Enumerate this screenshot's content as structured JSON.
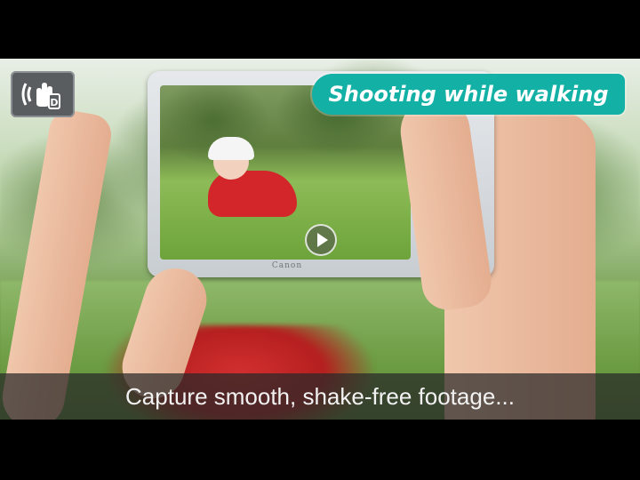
{
  "video": {
    "title_badge": "Shooting while walking",
    "caption": "Capture smooth, shake-free footage...",
    "camera_brand": "Canon",
    "mode_icon": "image-stabilizer-hand-icon",
    "play_icon": "play-icon",
    "colors": {
      "title_pill": "#12b0a5",
      "caption_bar": "#282828",
      "letterbox": "#000000"
    }
  }
}
